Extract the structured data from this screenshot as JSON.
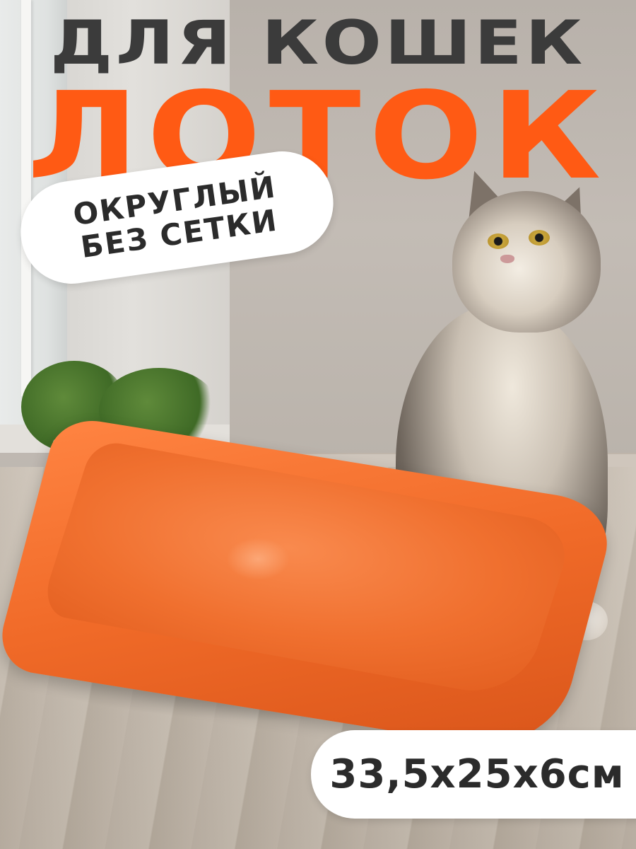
{
  "headline": {
    "top_line": "ДЛЯ КОШЕК",
    "main_word": "ЛОТОК"
  },
  "badge": {
    "line1": "ОКРУГЛЫЙ",
    "line2": "БЕЗ СЕТКИ"
  },
  "dimensions": "33,5х25х6см",
  "colors": {
    "accent": "#ff5a14",
    "text_dark": "#3b3b3b",
    "pill": "#ffffff"
  }
}
